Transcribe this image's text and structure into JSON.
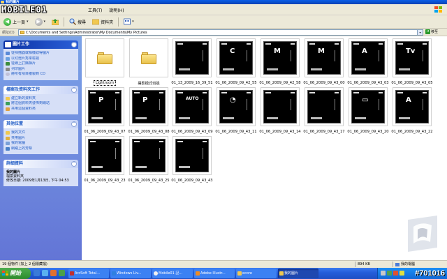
{
  "window": {
    "title": "我的圖片"
  },
  "logo": {
    "text": "MOBILE01"
  },
  "menu": [
    "工具(T)",
    "說明(H)"
  ],
  "toolbar": {
    "back_label": "上一頁",
    "search_label": "搜尋",
    "folders_label": "資料夾"
  },
  "address": {
    "label": "網址(D)",
    "path": "C:\\Documents and Settings\\Administrator\\My Documents\\My Pictures",
    "go_label": "移至"
  },
  "sidebar": {
    "picture_tasks": {
      "title": "圖片工作",
      "items": [
        "從掃描器或相機取得圖片",
        "以幻燈片秀來檢視",
        "從線上訂購相片",
        "列印圖片",
        "將所有項目複製到 CD"
      ]
    },
    "file_tasks": {
      "title": "檔案及資料夾工作",
      "items": [
        "建立新的資料夾",
        "將這個資料夾發佈到網站",
        "共用這個資料夾"
      ]
    },
    "other_places": {
      "title": "其他位置",
      "items": [
        "我的文件",
        "共用圖片",
        "我的電腦",
        "網路上的芳鄰"
      ]
    },
    "details": {
      "title": "詳細資料",
      "name": "我的圖片",
      "type": "檔案資料夾",
      "modified": "修改日期: 2009年1月13日, 下午 04:53"
    }
  },
  "files": [
    {
      "name": "Lightroom",
      "kind": "folder"
    },
    {
      "name": "攝影模式切換",
      "kind": "folder"
    },
    {
      "name": "01_13_2009_16_39_51",
      "kind": "image",
      "glyph": ""
    },
    {
      "name": "01_06_2009_09_42_55",
      "kind": "image",
      "glyph": "C"
    },
    {
      "name": "01_06_2009_09_42_58",
      "kind": "image",
      "glyph": "M"
    },
    {
      "name": "01_06_2009_09_43_00",
      "kind": "image",
      "glyph": "M"
    },
    {
      "name": "01_06_2009_09_43_03",
      "kind": "image",
      "glyph": "A"
    },
    {
      "name": "01_06_2009_09_43_05",
      "kind": "image",
      "glyph": "Tv"
    },
    {
      "name": "01_06_2009_09_43_07",
      "kind": "image",
      "glyph": "P"
    },
    {
      "name": "01_06_2009_09_43_08",
      "kind": "image",
      "glyph": "P"
    },
    {
      "name": "01_06_2009_09_43_09",
      "kind": "image",
      "glyph": "AUTO"
    },
    {
      "name": "01_06_2009_09_43_11",
      "kind": "image",
      "glyph": "◔"
    },
    {
      "name": "01_06_2009_09_43_14",
      "kind": "image",
      "glyph": ""
    },
    {
      "name": "01_06_2009_09_43_17",
      "kind": "image",
      "glyph": ""
    },
    {
      "name": "01_06_2009_09_43_20",
      "kind": "image",
      "glyph": "▭"
    },
    {
      "name": "01_06_2009_09_43_22",
      "kind": "image",
      "glyph": "A"
    },
    {
      "name": "01_06_2009_09_43_23",
      "kind": "image",
      "glyph": ""
    },
    {
      "name": "01_06_2009_09_43_25",
      "kind": "image",
      "glyph": ""
    },
    {
      "name": "01_06_2009_09_43_43",
      "kind": "image",
      "glyph": ""
    }
  ],
  "status": {
    "count": "19 個物件 (加上 2 個隱藏檔)",
    "size": "894 KB",
    "location": "我的電腦"
  },
  "taskbar": {
    "start": "開始",
    "buttons": [
      "ArcSoft Total...",
      "Windows Liv...",
      "Mobile01 記...",
      "Adobe Illustr...",
      "ecore",
      "我的圖片"
    ],
    "stamp": "#701016"
  }
}
